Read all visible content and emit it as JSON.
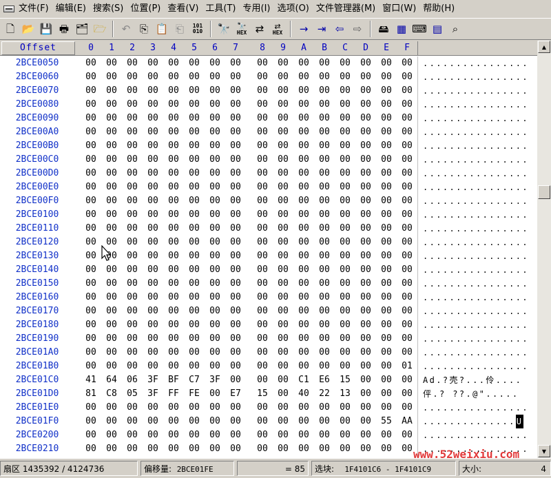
{
  "menu": [
    "文件(F)",
    "编辑(E)",
    "搜索(S)",
    "位置(P)",
    "查看(V)",
    "工具(T)",
    "专用(I)",
    "选项(O)",
    "文件管理器(M)",
    "窗口(W)",
    "帮助(H)"
  ],
  "toolbar": {
    "icons": [
      "new-file-icon",
      "open-folder-icon",
      "save-icon",
      "print-icon",
      "properties-icon",
      "open-disk-icon",
      "undo-icon",
      "copy-icon",
      "paste-icon",
      "paste-special-icon",
      "binary-icon",
      "find-icon",
      "find-hex-icon",
      "replace-icon",
      "replace-hex-icon",
      "goto-offset-icon",
      "goto-sector-icon",
      "back-icon",
      "forward-icon",
      "disk-icon",
      "ram-icon",
      "tool-icon",
      "calculator-icon",
      "search-icon"
    ],
    "hex_label": "HEX",
    "binary_label": "101\n010"
  },
  "header": {
    "offset_label": "Offset",
    "columns": [
      "0",
      "1",
      "2",
      "3",
      "4",
      "5",
      "6",
      "7",
      "8",
      "9",
      "A",
      "B",
      "C",
      "D",
      "E",
      "F"
    ]
  },
  "rows": [
    {
      "offset": "2BCE0050",
      "bytes": [
        "00",
        "00",
        "00",
        "00",
        "00",
        "00",
        "00",
        "00",
        "00",
        "00",
        "00",
        "00",
        "00",
        "00",
        "00",
        "00"
      ],
      "ascii": "................"
    },
    {
      "offset": "2BCE0060",
      "bytes": [
        "00",
        "00",
        "00",
        "00",
        "00",
        "00",
        "00",
        "00",
        "00",
        "00",
        "00",
        "00",
        "00",
        "00",
        "00",
        "00"
      ],
      "ascii": "................"
    },
    {
      "offset": "2BCE0070",
      "bytes": [
        "00",
        "00",
        "00",
        "00",
        "00",
        "00",
        "00",
        "00",
        "00",
        "00",
        "00",
        "00",
        "00",
        "00",
        "00",
        "00"
      ],
      "ascii": "................"
    },
    {
      "offset": "2BCE0080",
      "bytes": [
        "00",
        "00",
        "00",
        "00",
        "00",
        "00",
        "00",
        "00",
        "00",
        "00",
        "00",
        "00",
        "00",
        "00",
        "00",
        "00"
      ],
      "ascii": "................"
    },
    {
      "offset": "2BCE0090",
      "bytes": [
        "00",
        "00",
        "00",
        "00",
        "00",
        "00",
        "00",
        "00",
        "00",
        "00",
        "00",
        "00",
        "00",
        "00",
        "00",
        "00"
      ],
      "ascii": "................"
    },
    {
      "offset": "2BCE00A0",
      "bytes": [
        "00",
        "00",
        "00",
        "00",
        "00",
        "00",
        "00",
        "00",
        "00",
        "00",
        "00",
        "00",
        "00",
        "00",
        "00",
        "00"
      ],
      "ascii": "................"
    },
    {
      "offset": "2BCE00B0",
      "bytes": [
        "00",
        "00",
        "00",
        "00",
        "00",
        "00",
        "00",
        "00",
        "00",
        "00",
        "00",
        "00",
        "00",
        "00",
        "00",
        "00"
      ],
      "ascii": "................"
    },
    {
      "offset": "2BCE00C0",
      "bytes": [
        "00",
        "00",
        "00",
        "00",
        "00",
        "00",
        "00",
        "00",
        "00",
        "00",
        "00",
        "00",
        "00",
        "00",
        "00",
        "00"
      ],
      "ascii": "................"
    },
    {
      "offset": "2BCE00D0",
      "bytes": [
        "00",
        "00",
        "00",
        "00",
        "00",
        "00",
        "00",
        "00",
        "00",
        "00",
        "00",
        "00",
        "00",
        "00",
        "00",
        "00"
      ],
      "ascii": "................"
    },
    {
      "offset": "2BCE00E0",
      "bytes": [
        "00",
        "00",
        "00",
        "00",
        "00",
        "00",
        "00",
        "00",
        "00",
        "00",
        "00",
        "00",
        "00",
        "00",
        "00",
        "00"
      ],
      "ascii": "................"
    },
    {
      "offset": "2BCE00F0",
      "bytes": [
        "00",
        "00",
        "00",
        "00",
        "00",
        "00",
        "00",
        "00",
        "00",
        "00",
        "00",
        "00",
        "00",
        "00",
        "00",
        "00"
      ],
      "ascii": "................"
    },
    {
      "offset": "2BCE0100",
      "bytes": [
        "00",
        "00",
        "00",
        "00",
        "00",
        "00",
        "00",
        "00",
        "00",
        "00",
        "00",
        "00",
        "00",
        "00",
        "00",
        "00"
      ],
      "ascii": "................"
    },
    {
      "offset": "2BCE0110",
      "bytes": [
        "00",
        "00",
        "00",
        "00",
        "00",
        "00",
        "00",
        "00",
        "00",
        "00",
        "00",
        "00",
        "00",
        "00",
        "00",
        "00"
      ],
      "ascii": "................"
    },
    {
      "offset": "2BCE0120",
      "bytes": [
        "00",
        "00",
        "00",
        "00",
        "00",
        "00",
        "00",
        "00",
        "00",
        "00",
        "00",
        "00",
        "00",
        "00",
        "00",
        "00"
      ],
      "ascii": "................"
    },
    {
      "offset": "2BCE0130",
      "bytes": [
        "00",
        "00",
        "00",
        "00",
        "00",
        "00",
        "00",
        "00",
        "00",
        "00",
        "00",
        "00",
        "00",
        "00",
        "00",
        "00"
      ],
      "ascii": "................"
    },
    {
      "offset": "2BCE0140",
      "bytes": [
        "00",
        "00",
        "00",
        "00",
        "00",
        "00",
        "00",
        "00",
        "00",
        "00",
        "00",
        "00",
        "00",
        "00",
        "00",
        "00"
      ],
      "ascii": "................"
    },
    {
      "offset": "2BCE0150",
      "bytes": [
        "00",
        "00",
        "00",
        "00",
        "00",
        "00",
        "00",
        "00",
        "00",
        "00",
        "00",
        "00",
        "00",
        "00",
        "00",
        "00"
      ],
      "ascii": "................"
    },
    {
      "offset": "2BCE0160",
      "bytes": [
        "00",
        "00",
        "00",
        "00",
        "00",
        "00",
        "00",
        "00",
        "00",
        "00",
        "00",
        "00",
        "00",
        "00",
        "00",
        "00"
      ],
      "ascii": "................"
    },
    {
      "offset": "2BCE0170",
      "bytes": [
        "00",
        "00",
        "00",
        "00",
        "00",
        "00",
        "00",
        "00",
        "00",
        "00",
        "00",
        "00",
        "00",
        "00",
        "00",
        "00"
      ],
      "ascii": "................"
    },
    {
      "offset": "2BCE0180",
      "bytes": [
        "00",
        "00",
        "00",
        "00",
        "00",
        "00",
        "00",
        "00",
        "00",
        "00",
        "00",
        "00",
        "00",
        "00",
        "00",
        "00"
      ],
      "ascii": "................"
    },
    {
      "offset": "2BCE0190",
      "bytes": [
        "00",
        "00",
        "00",
        "00",
        "00",
        "00",
        "00",
        "00",
        "00",
        "00",
        "00",
        "00",
        "00",
        "00",
        "00",
        "00"
      ],
      "ascii": "................"
    },
    {
      "offset": "2BCE01A0",
      "bytes": [
        "00",
        "00",
        "00",
        "00",
        "00",
        "00",
        "00",
        "00",
        "00",
        "00",
        "00",
        "00",
        "00",
        "00",
        "00",
        "00"
      ],
      "ascii": "................"
    },
    {
      "offset": "2BCE01B0",
      "bytes": [
        "00",
        "00",
        "00",
        "00",
        "00",
        "00",
        "00",
        "00",
        "00",
        "00",
        "00",
        "00",
        "00",
        "00",
        "00",
        "01"
      ],
      "ascii": "................"
    },
    {
      "offset": "2BCE01C0",
      "bytes": [
        "41",
        "64",
        "06",
        "3F",
        "BF",
        "C7",
        "3F",
        "00",
        "00",
        "00",
        "C1",
        "E6",
        "15",
        "00",
        "00",
        "00"
      ],
      "ascii": "Ad.?壳?...伶...."
    },
    {
      "offset": "2BCE01D0",
      "bytes": [
        "81",
        "C8",
        "05",
        "3F",
        "FF",
        "FE",
        "00",
        "E7",
        "15",
        "00",
        "40",
        "22",
        "13",
        "00",
        "00",
        "00"
      ],
      "ascii": "伻.? ??.@\"....."
    },
    {
      "offset": "2BCE01E0",
      "bytes": [
        "00",
        "00",
        "00",
        "00",
        "00",
        "00",
        "00",
        "00",
        "00",
        "00",
        "00",
        "00",
        "00",
        "00",
        "00",
        "00"
      ],
      "ascii": "................"
    },
    {
      "offset": "2BCE01F0",
      "bytes": [
        "00",
        "00",
        "00",
        "00",
        "00",
        "00",
        "00",
        "00",
        "00",
        "00",
        "00",
        "00",
        "00",
        "00",
        "55",
        "AA"
      ],
      "ascii": "..............",
      "cursor_char": "U"
    },
    {
      "offset": "2BCE0200",
      "bytes": [
        "00",
        "00",
        "00",
        "00",
        "00",
        "00",
        "00",
        "00",
        "00",
        "00",
        "00",
        "00",
        "00",
        "00",
        "00",
        "00"
      ],
      "ascii": "................"
    },
    {
      "offset": "2BCE0210",
      "bytes": [
        "00",
        "00",
        "00",
        "00",
        "00",
        "00",
        "00",
        "00",
        "00",
        "00",
        "00",
        "00",
        "00",
        "00",
        "00",
        "00"
      ],
      "ascii": "................"
    }
  ],
  "status": {
    "sector": "扇区 1435392 / 4124736",
    "offset_label": "偏移量:",
    "offset_value": "2BCE01FE",
    "value": "= 85",
    "block_label": "选块:",
    "block_value": "1F4101C6 - 1F4101C9",
    "size_label": "大小:",
    "size_value": "4"
  },
  "watermark": "www.52weixiu.com"
}
